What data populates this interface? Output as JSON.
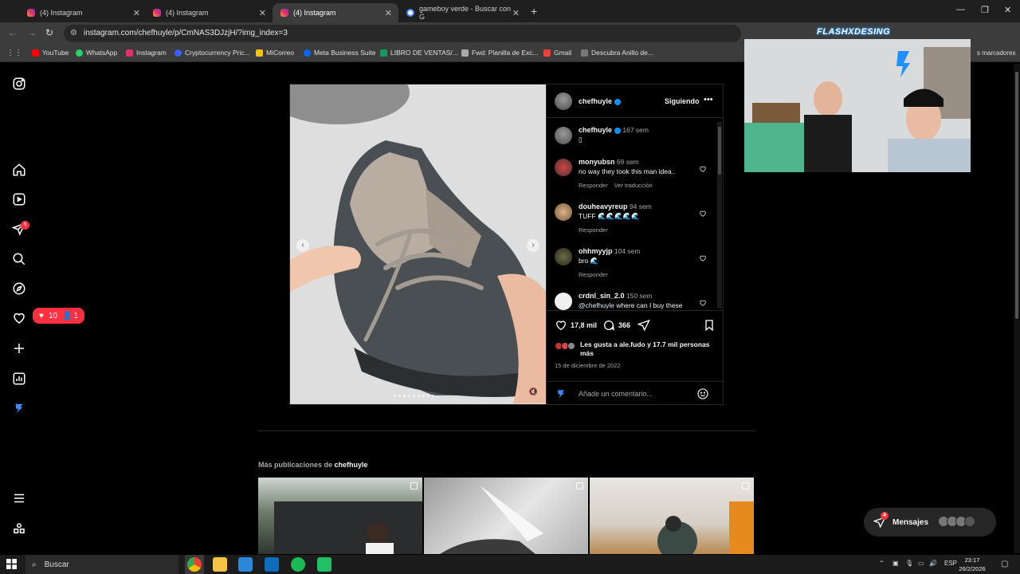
{
  "browser": {
    "tabs": [
      {
        "title": "(4) Instagram",
        "icon": "instagram-icon",
        "active": false
      },
      {
        "title": "(4) Instagram",
        "icon": "instagram-icon",
        "active": false
      },
      {
        "title": "(4) Instagram",
        "icon": "instagram-icon",
        "active": true
      },
      {
        "title": "gameboy verde - Buscar con G",
        "icon": "google-icon",
        "active": false
      }
    ],
    "url": "instagram.com/chefhuyle/p/CmNAS3DJzjH/?img_index=3",
    "bookmarks": [
      {
        "label": "YouTube",
        "color": "#ff0000"
      },
      {
        "label": "WhatsApp",
        "color": "#25d366"
      },
      {
        "label": "Instagram",
        "color": "#e1306c"
      },
      {
        "label": "Cryptocurrency Pric...",
        "color": "#3861fb"
      },
      {
        "label": "MiCorreo",
        "color": "#f5c400"
      },
      {
        "label": "Meta Business Suite",
        "color": "#0866ff"
      },
      {
        "label": "LIBRO DE VENTAS/...",
        "color": "#0f9d58"
      },
      {
        "label": "Fwd: Planilla de Exc...",
        "color": "#aaaaaa"
      },
      {
        "label": "Gmail",
        "color": "#ea4335"
      },
      {
        "label": "Descubra Anillo de...",
        "color": "#777777"
      }
    ],
    "bookmarks_overflow": "s marcadores"
  },
  "instagram": {
    "sidebar_badge": "5",
    "notifications": {
      "likes": "10",
      "follows": "1"
    },
    "post": {
      "author": "chefhuyle",
      "follow_label": "Siguiendo",
      "caption_time": "167 sem",
      "caption_text": "▯",
      "comments": [
        {
          "user": "monyubsn",
          "time": "69 sem",
          "text": "no way they took this man idea..",
          "reply": "Responder",
          "translate": "Ver traducción"
        },
        {
          "user": "douheavyreup",
          "time": "94 sem",
          "text": "TUFF 🌊🌊🌊🌊🌊",
          "reply": "Responder",
          "translate": ""
        },
        {
          "user": "ohhmyyjp",
          "time": "104 sem",
          "text": "bro 🌊",
          "reply": "Responder",
          "translate": ""
        },
        {
          "user": "crdnl_sin_2.0",
          "time": "150 sem",
          "mention": "@chefhuyle",
          "text": " where can I buy these",
          "reply": "",
          "translate": ""
        }
      ],
      "likes_count": "17,8 mil",
      "comments_count": "366",
      "liked_by": "Les gusta a ale.fudo y 17.7 mil personas más",
      "date": "15 de diciembre de 2022",
      "comment_placeholder": "Añade un comentario...",
      "carousel": {
        "count": 9,
        "active": 2
      }
    },
    "more_posts_prefix": "Más publicaciones de ",
    "more_posts_user": "chefhuyle",
    "messages_label": "Mensajes",
    "messages_badge": "4"
  },
  "overlay": {
    "channel": "FLASHXDESING"
  },
  "taskbar": {
    "search_label": "Buscar",
    "language": "ESP",
    "time": "23:17",
    "date": "26/2/2026"
  },
  "colors": {
    "notification_red": "#ff3040",
    "verified_blue": "#0095f6",
    "background": "#000000"
  }
}
